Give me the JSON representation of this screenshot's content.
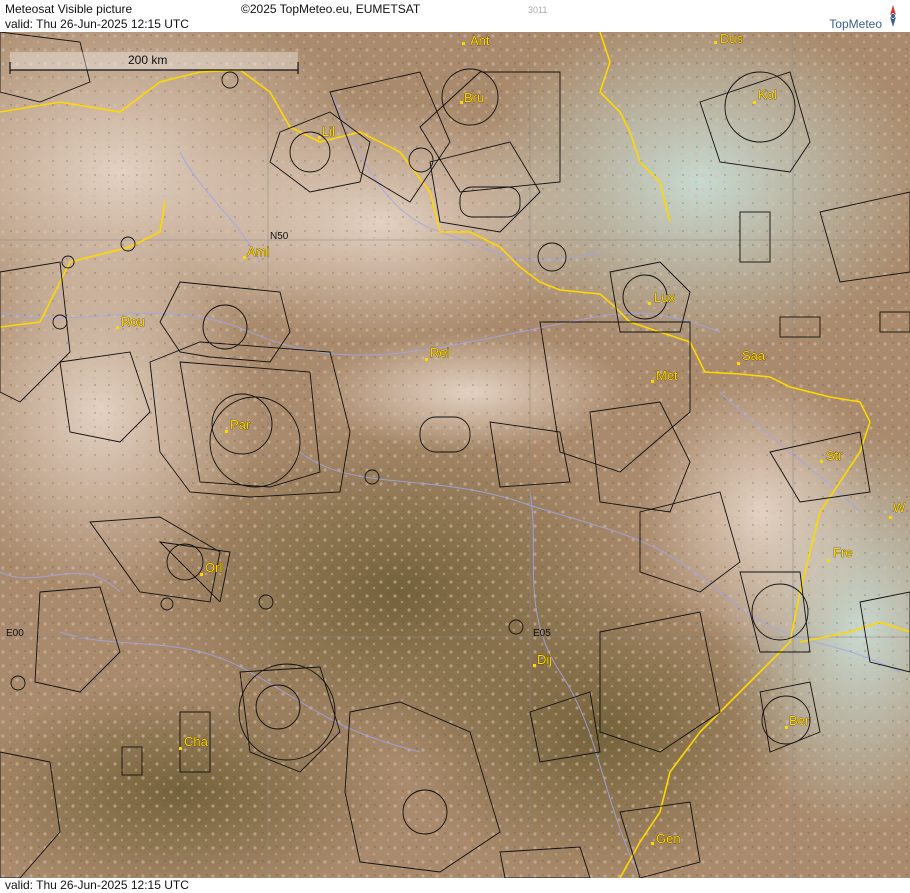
{
  "header": {
    "title": "Meteosat Visible picture",
    "copyright": "©2025 TopMeteo.eu, EUMETSAT",
    "code": "3011",
    "valid": "valid:  Thu  26-Jun-2025  12:15 UTC"
  },
  "logo": {
    "text": "TopMeteo",
    "icon": "compass-icon"
  },
  "footer": {
    "valid": "valid:  Thu  26-Jun-2025  12:15 UTC"
  },
  "scale": {
    "label": "200 km"
  },
  "grid_labels": {
    "lat": "N50",
    "lon_west": "E00",
    "lon_east": "E05"
  },
  "cities": [
    "Ant",
    "Dus",
    "Bru",
    "Kol",
    "Lil",
    "Ami",
    "Lux",
    "Rou",
    "Rei",
    "Saa",
    "Met",
    "Par",
    "Str",
    "Fre",
    "Orl",
    "W",
    "Dij",
    "Ber",
    "Cha",
    "Gen"
  ],
  "colors": {
    "border": "#ffd800",
    "rivers": "#9fa6e8",
    "airspace": "#111111",
    "grid": "#8a8a8a",
    "city": "#ffd800"
  }
}
